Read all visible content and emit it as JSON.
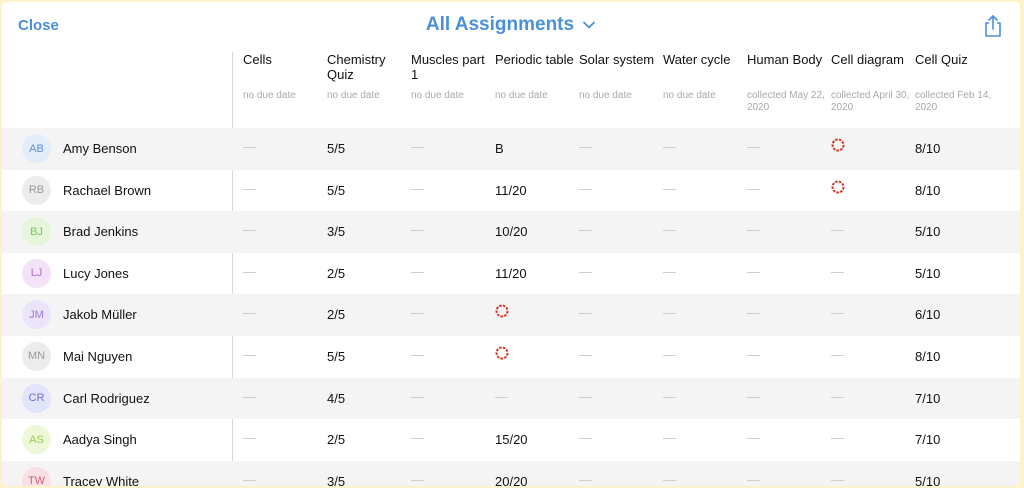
{
  "topbar": {
    "close_label": "Close",
    "title": "All Assignments",
    "accent_color": "#4a90d9"
  },
  "columns": [
    {
      "title": "Cells",
      "sub": "no due date"
    },
    {
      "title": "Chemistry Quiz",
      "sub": "no due date"
    },
    {
      "title": "Muscles part 1",
      "sub": "no due date"
    },
    {
      "title": "Periodic table",
      "sub": "no due date"
    },
    {
      "title": "Solar system",
      "sub": "no due date"
    },
    {
      "title": "Water cycle",
      "sub": "no due date"
    },
    {
      "title": "Human Body",
      "sub": "collected May 22, 2020"
    },
    {
      "title": "Cell diagram",
      "sub": "collected April 30, 2020"
    },
    {
      "title": "Cell Quiz",
      "sub": "collected Feb 14, 2020"
    }
  ],
  "students": [
    {
      "initials": "AB",
      "name": "Amy Benson",
      "avatar_bg": "#e3ecfb",
      "avatar_fg": "#5b8fd8",
      "cells": [
        "—",
        "5/5",
        "—",
        "B",
        "—",
        "—",
        "—",
        "ring",
        "8/10"
      ]
    },
    {
      "initials": "RB",
      "name": "Rachael Brown",
      "avatar_bg": "#ececec",
      "avatar_fg": "#999999",
      "cells": [
        "—",
        "5/5",
        "—",
        "11/20",
        "—",
        "—",
        "—",
        "ring",
        "8/10"
      ]
    },
    {
      "initials": "BJ",
      "name": "Brad Jenkins",
      "avatar_bg": "#e6f6dc",
      "avatar_fg": "#7cc257",
      "cells": [
        "—",
        "3/5",
        "—",
        "10/20",
        "—",
        "—",
        "—",
        "—",
        "5/10"
      ]
    },
    {
      "initials": "LJ",
      "name": "Lucy Jones",
      "avatar_bg": "#f3e2f8",
      "avatar_fg": "#b766cf",
      "cells": [
        "—",
        "2/5",
        "—",
        "11/20",
        "—",
        "—",
        "—",
        "—",
        "5/10"
      ]
    },
    {
      "initials": "JM",
      "name": "Jakob Müller",
      "avatar_bg": "#ece4fa",
      "avatar_fg": "#9a7bd6",
      "cells": [
        "—",
        "2/5",
        "—",
        "ring",
        "—",
        "—",
        "—",
        "—",
        "6/10"
      ]
    },
    {
      "initials": "MN",
      "name": "Mai Nguyen",
      "avatar_bg": "#ececec",
      "avatar_fg": "#999999",
      "cells": [
        "—",
        "5/5",
        "—",
        "ring",
        "—",
        "—",
        "—",
        "—",
        "8/10"
      ]
    },
    {
      "initials": "CR",
      "name": "Carl Rodriguez",
      "avatar_bg": "#e2e4fa",
      "avatar_fg": "#6b74d8",
      "cells": [
        "—",
        "4/5",
        "—",
        "—",
        "—",
        "—",
        "—",
        "—",
        "7/10"
      ]
    },
    {
      "initials": "AS",
      "name": "Aadya Singh",
      "avatar_bg": "#eef8d8",
      "avatar_fg": "#9cc84a",
      "cells": [
        "—",
        "2/5",
        "—",
        "15/20",
        "—",
        "—",
        "—",
        "—",
        "7/10"
      ]
    },
    {
      "initials": "TW",
      "name": "Tracey White",
      "avatar_bg": "#f9e0e4",
      "avatar_fg": "#d0607a",
      "cells": [
        "—",
        "3/5",
        "—",
        "20/20",
        "—",
        "—",
        "—",
        "—",
        "5/10"
      ]
    }
  ],
  "icons": {
    "share": "share-icon",
    "chevron": "chevron-down-icon",
    "in_progress": "in-progress-ring-icon",
    "ring_color": "#d0392b"
  }
}
